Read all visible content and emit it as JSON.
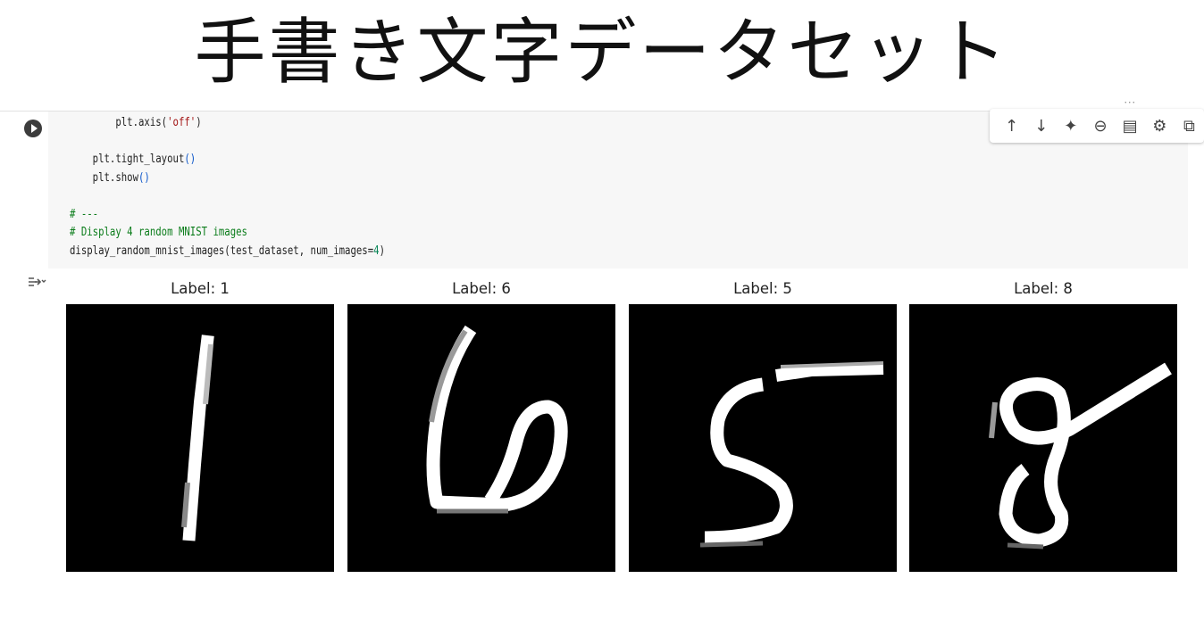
{
  "slide_title": "手書き文字データセット",
  "notebook": {
    "top_right_fragment": "･･･",
    "code_lines": [
      [
        {
          "t": "        plt.axis(",
          "c": ""
        },
        {
          "t": "'off'",
          "c": "str"
        },
        {
          "t": ")",
          "c": ""
        }
      ],
      [
        {
          "t": "",
          "c": ""
        }
      ],
      [
        {
          "t": "    plt.tight_layout",
          "c": ""
        },
        {
          "t": "()",
          "c": "par"
        }
      ],
      [
        {
          "t": "    plt.show",
          "c": ""
        },
        {
          "t": "()",
          "c": "par"
        }
      ],
      [
        {
          "t": "",
          "c": ""
        }
      ],
      [
        {
          "t": "# ---",
          "c": "cm"
        }
      ],
      [
        {
          "t": "# Display 4 random MNIST images",
          "c": "cm"
        }
      ],
      [
        {
          "t": "display_random_mnist_images(test_dataset, num_images=",
          "c": ""
        },
        {
          "t": "4",
          "c": "num"
        },
        {
          "t": ")",
          "c": ""
        }
      ]
    ],
    "toolbar": [
      {
        "name": "move-up-icon",
        "glyph": "↑"
      },
      {
        "name": "move-down-icon",
        "glyph": "↓"
      },
      {
        "name": "gemini-sparkle-icon",
        "glyph": "✦"
      },
      {
        "name": "link-icon",
        "glyph": "⊖"
      },
      {
        "name": "comment-icon",
        "glyph": "▤"
      },
      {
        "name": "settings-gear-icon",
        "glyph": "⚙"
      },
      {
        "name": "mirror-cell-icon",
        "glyph": "⧉"
      }
    ]
  },
  "output": {
    "panels": [
      {
        "label": "Label: 1"
      },
      {
        "label": "Label: 6"
      },
      {
        "label": "Label: 5"
      },
      {
        "label": "Label: 8"
      }
    ]
  }
}
